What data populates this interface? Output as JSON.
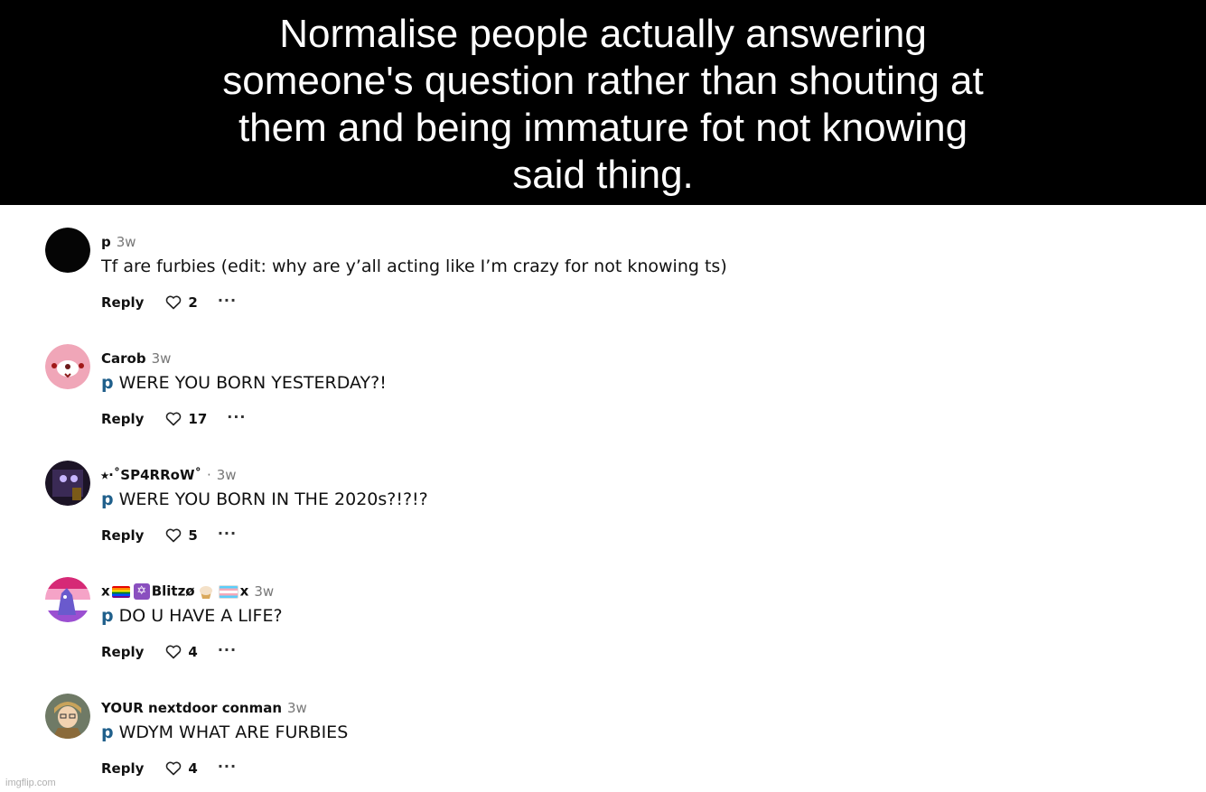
{
  "banner": {
    "text": "Normalise people actually answering someone's question rather than shouting at them and being immature fot not knowing said thing."
  },
  "comments": [
    {
      "username": "p",
      "time": "3w",
      "mention": "",
      "text": "Tf are furbies (edit: why are y’all acting like I’m crazy for not knowing ts)",
      "reply_label": "Reply",
      "likes": "2",
      "more_label": "···"
    },
    {
      "username": "Carob",
      "time": "3w",
      "mention": "p",
      "text": "WERE YOU BORN YESTERDAY?!",
      "reply_label": "Reply",
      "likes": "17",
      "more_label": "···"
    },
    {
      "username": "⭑·˚SP4RRoW˚",
      "username_suffix": "·",
      "time": "3w",
      "mention": "p",
      "text": "WERE YOU BORN IN THE 2020s?!?!?",
      "reply_label": "Reply",
      "likes": "5",
      "more_label": "···"
    },
    {
      "username_parts": [
        "x",
        "Blitzø",
        "x"
      ],
      "time": "3w",
      "mention": "p",
      "text": "DO U HAVE A LIFE?",
      "reply_label": "Reply",
      "likes": "4",
      "more_label": "···"
    },
    {
      "username": "YOUR nextdoor conman",
      "time": "3w",
      "mention": "p",
      "text": "WDYM WHAT ARE FURBIES",
      "reply_label": "Reply",
      "likes": "4",
      "more_label": "···"
    }
  ],
  "icons": [
    "heart-icon",
    "more-icon",
    "rainbow-flag-icon",
    "star-of-david-icon",
    "cupcake-icon",
    "trans-flag-icon"
  ],
  "colors": {
    "banner_bg": "#000000",
    "banner_text": "#ffffff",
    "mention": "#1f5f8b",
    "timestamp": "#777777"
  },
  "watermark": "imgflip.com"
}
